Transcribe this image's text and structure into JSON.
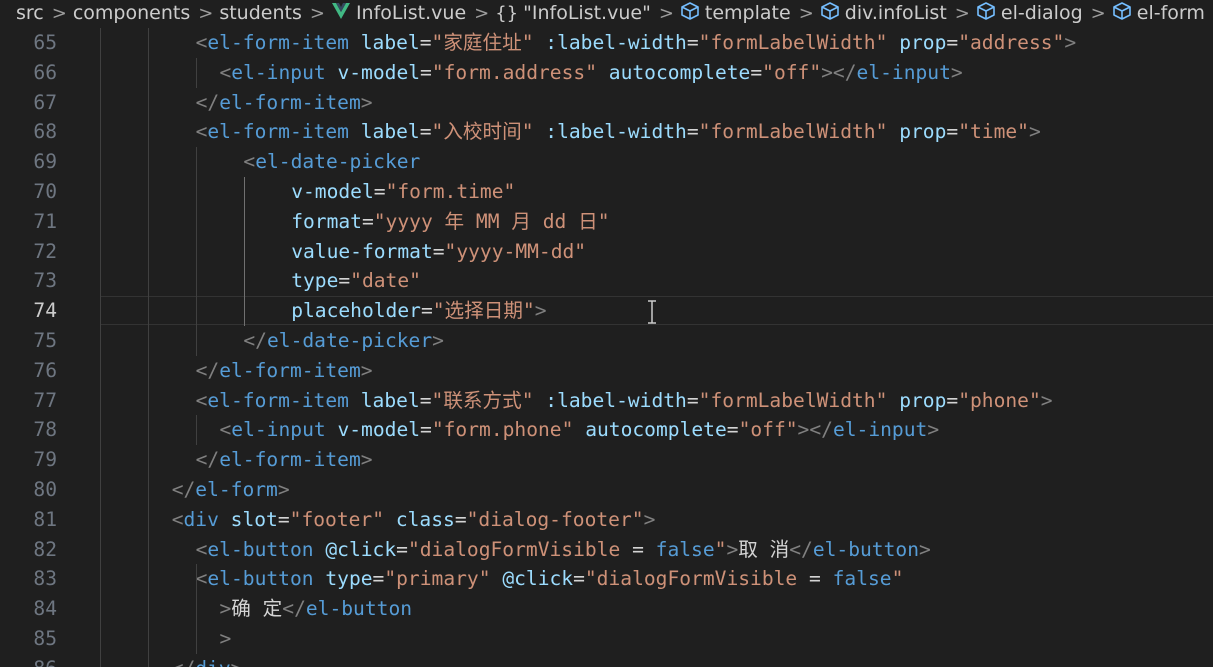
{
  "breadcrumb": {
    "items": [
      {
        "label": "src",
        "icon": ""
      },
      {
        "label": "components",
        "icon": ""
      },
      {
        "label": "students",
        "icon": ""
      },
      {
        "label": "InfoList.vue",
        "icon": "vue-file-icon"
      },
      {
        "label": "\"InfoList.vue\"",
        "icon": "braces-icon"
      },
      {
        "label": "template",
        "icon": "cube-icon"
      },
      {
        "label": "div.infoList",
        "icon": "cube-icon"
      },
      {
        "label": "el-dialog",
        "icon": "cube-icon"
      },
      {
        "label": "el-form",
        "icon": "cube-icon"
      },
      {
        "label": "",
        "icon": "cube-icon"
      }
    ],
    "separator": ">"
  },
  "editor": {
    "active_line": 74,
    "colors": {
      "tag": "#569cd6",
      "attr": "#9cdcfe",
      "string": "#ce9178",
      "punct": "#808080",
      "text": "#d4d4d4",
      "background": "#1f1f1f"
    },
    "lines": [
      {
        "n": "65",
        "indent": 4,
        "tokens": [
          [
            "p",
            "<"
          ],
          [
            "tag",
            "el-form-item"
          ],
          [
            "t",
            " "
          ],
          [
            "attr",
            "label"
          ],
          [
            "t",
            "="
          ],
          [
            "str",
            "\"家庭住址\""
          ],
          [
            "t",
            " "
          ],
          [
            "attr",
            ":label-width"
          ],
          [
            "t",
            "="
          ],
          [
            "str2",
            "\"formLabelWidth\""
          ],
          [
            "t",
            " "
          ],
          [
            "attr",
            "prop"
          ],
          [
            "t",
            "="
          ],
          [
            "str",
            "\"address\""
          ],
          [
            "p",
            ">"
          ]
        ]
      },
      {
        "n": "66",
        "indent": 5,
        "tokens": [
          [
            "p",
            "<"
          ],
          [
            "tag",
            "el-input"
          ],
          [
            "t",
            " "
          ],
          [
            "attr",
            "v-model"
          ],
          [
            "t",
            "="
          ],
          [
            "str2",
            "\"form.address\""
          ],
          [
            "t",
            " "
          ],
          [
            "attr",
            "autocomplete"
          ],
          [
            "t",
            "="
          ],
          [
            "str",
            "\"off\""
          ],
          [
            "p",
            "></"
          ],
          [
            "tag",
            "el-input"
          ],
          [
            "p",
            ">"
          ]
        ]
      },
      {
        "n": "67",
        "indent": 4,
        "tokens": [
          [
            "p",
            "</"
          ],
          [
            "tag",
            "el-form-item"
          ],
          [
            "p",
            ">"
          ]
        ]
      },
      {
        "n": "68",
        "indent": 4,
        "tokens": [
          [
            "p",
            "<"
          ],
          [
            "tag",
            "el-form-item"
          ],
          [
            "t",
            " "
          ],
          [
            "attr",
            "label"
          ],
          [
            "t",
            "="
          ],
          [
            "str",
            "\"入校时间\""
          ],
          [
            "t",
            " "
          ],
          [
            "attr",
            ":label-width"
          ],
          [
            "t",
            "="
          ],
          [
            "str2",
            "\"formLabelWidth\""
          ],
          [
            "t",
            " "
          ],
          [
            "attr",
            "prop"
          ],
          [
            "t",
            "="
          ],
          [
            "str",
            "\"time\""
          ],
          [
            "p",
            ">"
          ]
        ]
      },
      {
        "n": "69",
        "indent": 6,
        "tokens": [
          [
            "p",
            "<"
          ],
          [
            "tag",
            "el-date-picker"
          ]
        ]
      },
      {
        "n": "70",
        "indent": 8,
        "tokens": [
          [
            "attr",
            "v-model"
          ],
          [
            "t",
            "="
          ],
          [
            "str2",
            "\"form.time\""
          ]
        ]
      },
      {
        "n": "71",
        "indent": 8,
        "tokens": [
          [
            "attr",
            "format"
          ],
          [
            "t",
            "="
          ],
          [
            "str",
            "\"yyyy 年 MM 月 dd 日\""
          ]
        ]
      },
      {
        "n": "72",
        "indent": 8,
        "tokens": [
          [
            "attr",
            "value-format"
          ],
          [
            "t",
            "="
          ],
          [
            "str",
            "\"yyyy-MM-dd\""
          ]
        ]
      },
      {
        "n": "73",
        "indent": 8,
        "tokens": [
          [
            "attr",
            "type"
          ],
          [
            "t",
            "="
          ],
          [
            "str",
            "\"date\""
          ]
        ]
      },
      {
        "n": "74",
        "indent": 8,
        "tokens": [
          [
            "attr",
            "placeholder"
          ],
          [
            "t",
            "="
          ],
          [
            "str",
            "\"选择日期\""
          ],
          [
            "p",
            ">"
          ]
        ]
      },
      {
        "n": "75",
        "indent": 6,
        "tokens": [
          [
            "p",
            "</"
          ],
          [
            "tag",
            "el-date-picker"
          ],
          [
            "p",
            ">"
          ]
        ]
      },
      {
        "n": "76",
        "indent": 4,
        "tokens": [
          [
            "p",
            "</"
          ],
          [
            "tag",
            "el-form-item"
          ],
          [
            "p",
            ">"
          ]
        ]
      },
      {
        "n": "77",
        "indent": 4,
        "tokens": [
          [
            "p",
            "<"
          ],
          [
            "tag",
            "el-form-item"
          ],
          [
            "t",
            " "
          ],
          [
            "attr",
            "label"
          ],
          [
            "t",
            "="
          ],
          [
            "str",
            "\"联系方式\""
          ],
          [
            "t",
            " "
          ],
          [
            "attr",
            ":label-width"
          ],
          [
            "t",
            "="
          ],
          [
            "str2",
            "\"formLabelWidth\""
          ],
          [
            "t",
            " "
          ],
          [
            "attr",
            "prop"
          ],
          [
            "t",
            "="
          ],
          [
            "str",
            "\"phone\""
          ],
          [
            "p",
            ">"
          ]
        ]
      },
      {
        "n": "78",
        "indent": 5,
        "tokens": [
          [
            "p",
            "<"
          ],
          [
            "tag",
            "el-input"
          ],
          [
            "t",
            " "
          ],
          [
            "attr",
            "v-model"
          ],
          [
            "t",
            "="
          ],
          [
            "str2",
            "\"form.phone\""
          ],
          [
            "t",
            " "
          ],
          [
            "attr",
            "autocomplete"
          ],
          [
            "t",
            "="
          ],
          [
            "str",
            "\"off\""
          ],
          [
            "p",
            "></"
          ],
          [
            "tag",
            "el-input"
          ],
          [
            "p",
            ">"
          ]
        ]
      },
      {
        "n": "79",
        "indent": 4,
        "tokens": [
          [
            "p",
            "</"
          ],
          [
            "tag",
            "el-form-item"
          ],
          [
            "p",
            ">"
          ]
        ]
      },
      {
        "n": "80",
        "indent": 3,
        "tokens": [
          [
            "p",
            "</"
          ],
          [
            "tag",
            "el-form"
          ],
          [
            "p",
            ">"
          ]
        ]
      },
      {
        "n": "81",
        "indent": 3,
        "tokens": [
          [
            "p",
            "<"
          ],
          [
            "tag",
            "div"
          ],
          [
            "t",
            " "
          ],
          [
            "attr",
            "slot"
          ],
          [
            "t",
            "="
          ],
          [
            "str",
            "\"footer\""
          ],
          [
            "t",
            " "
          ],
          [
            "attr",
            "class"
          ],
          [
            "t",
            "="
          ],
          [
            "str",
            "\"dialog-footer\""
          ],
          [
            "p",
            ">"
          ]
        ]
      },
      {
        "n": "82",
        "indent": 4,
        "tokens": [
          [
            "p",
            "<"
          ],
          [
            "tag",
            "el-button"
          ],
          [
            "t",
            " "
          ],
          [
            "attr",
            "@click"
          ],
          [
            "t",
            "="
          ],
          [
            "str2",
            "\"dialogFormVisible"
          ],
          [
            "t",
            " = "
          ],
          [
            "kw",
            "false"
          ],
          [
            "str2",
            "\""
          ],
          [
            "p",
            ">"
          ],
          [
            "t",
            "取 消"
          ],
          [
            "p",
            "</"
          ],
          [
            "tag",
            "el-button"
          ],
          [
            "p",
            ">"
          ]
        ]
      },
      {
        "n": "83",
        "indent": 4,
        "tokens": [
          [
            "p",
            "<"
          ],
          [
            "tag",
            "el-button"
          ],
          [
            "t",
            " "
          ],
          [
            "attr",
            "type"
          ],
          [
            "t",
            "="
          ],
          [
            "str",
            "\"primary\""
          ],
          [
            "t",
            " "
          ],
          [
            "attr",
            "@click"
          ],
          [
            "t",
            "="
          ],
          [
            "str2",
            "\"dialogFormVisible"
          ],
          [
            "t",
            " = "
          ],
          [
            "kw",
            "false"
          ],
          [
            "str2",
            "\""
          ]
        ]
      },
      {
        "n": "84",
        "indent": 5,
        "tokens": [
          [
            "p",
            ">"
          ],
          [
            "t",
            "确 定"
          ],
          [
            "p",
            "</"
          ],
          [
            "tag",
            "el-button"
          ]
        ]
      },
      {
        "n": "85",
        "indent": 5,
        "tokens": [
          [
            "p",
            ">"
          ]
        ]
      },
      {
        "n": "86",
        "indent": 3,
        "tokens": [
          [
            "p",
            "</"
          ],
          [
            "tag",
            "div"
          ],
          [
            "p",
            ">"
          ]
        ]
      }
    ]
  }
}
